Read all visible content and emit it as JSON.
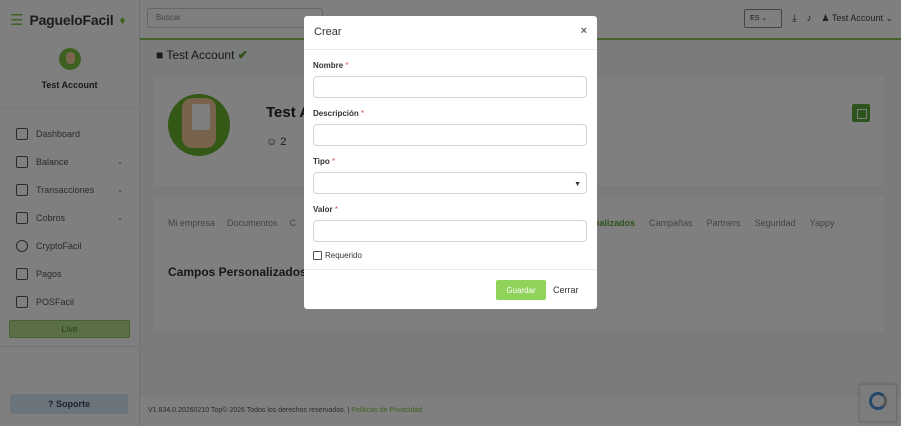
{
  "brand": {
    "name": "PagueloFacil"
  },
  "sidebar": {
    "account_name": "Test Account",
    "items": [
      {
        "label": "Dashboard",
        "icon": "dashboard-icon",
        "expandable": false
      },
      {
        "label": "Balance",
        "icon": "balance-icon",
        "expandable": true
      },
      {
        "label": "Transacciones",
        "icon": "file-icon",
        "expandable": true
      },
      {
        "label": "Cobros",
        "icon": "cobros-icon",
        "expandable": true
      },
      {
        "label": "CryptoFacil",
        "icon": "crypto-icon",
        "expandable": false
      },
      {
        "label": "Pagos",
        "icon": "pagos-icon",
        "expandable": false
      },
      {
        "label": "POSFacil",
        "icon": "pos-icon",
        "expandable": false
      }
    ],
    "live_label": "Live",
    "support_label": "Soporte"
  },
  "topbar": {
    "search_placeholder": "Buscar",
    "language": "ES",
    "user_label": "Test Account"
  },
  "main": {
    "breadcrumb": "Test Account",
    "profile_title": "Test A",
    "user_count": "2",
    "tabs_left": [
      "Mi empresa",
      "Documentos",
      "C"
    ],
    "tabs_right": [
      "nalizados",
      "Campañas",
      "Partners",
      "Seguridad",
      "Yappy"
    ],
    "section_title": "Campos Personalizados"
  },
  "footer": {
    "text": "V1.834.0.20260210  Top© 2026 Todos los derechos reservados. |",
    "link": "Políticas de Privacidad"
  },
  "modal": {
    "title": "Crear",
    "close_glyph": "×",
    "fields": {
      "nombre": {
        "label": "Nombre",
        "value": ""
      },
      "descripcion": {
        "label": "Descripción",
        "value": ""
      },
      "tipo": {
        "label": "Tipo",
        "selected": ""
      },
      "valor": {
        "label": "Valor",
        "value": ""
      }
    },
    "required_mark": "*",
    "checkbox_label": "Requerido",
    "save_label": "Guardar",
    "cancel_label": "Cerrar"
  },
  "colors": {
    "accent": "#7cc242",
    "save_button": "#8fd35a",
    "required": "#e24b4b"
  }
}
